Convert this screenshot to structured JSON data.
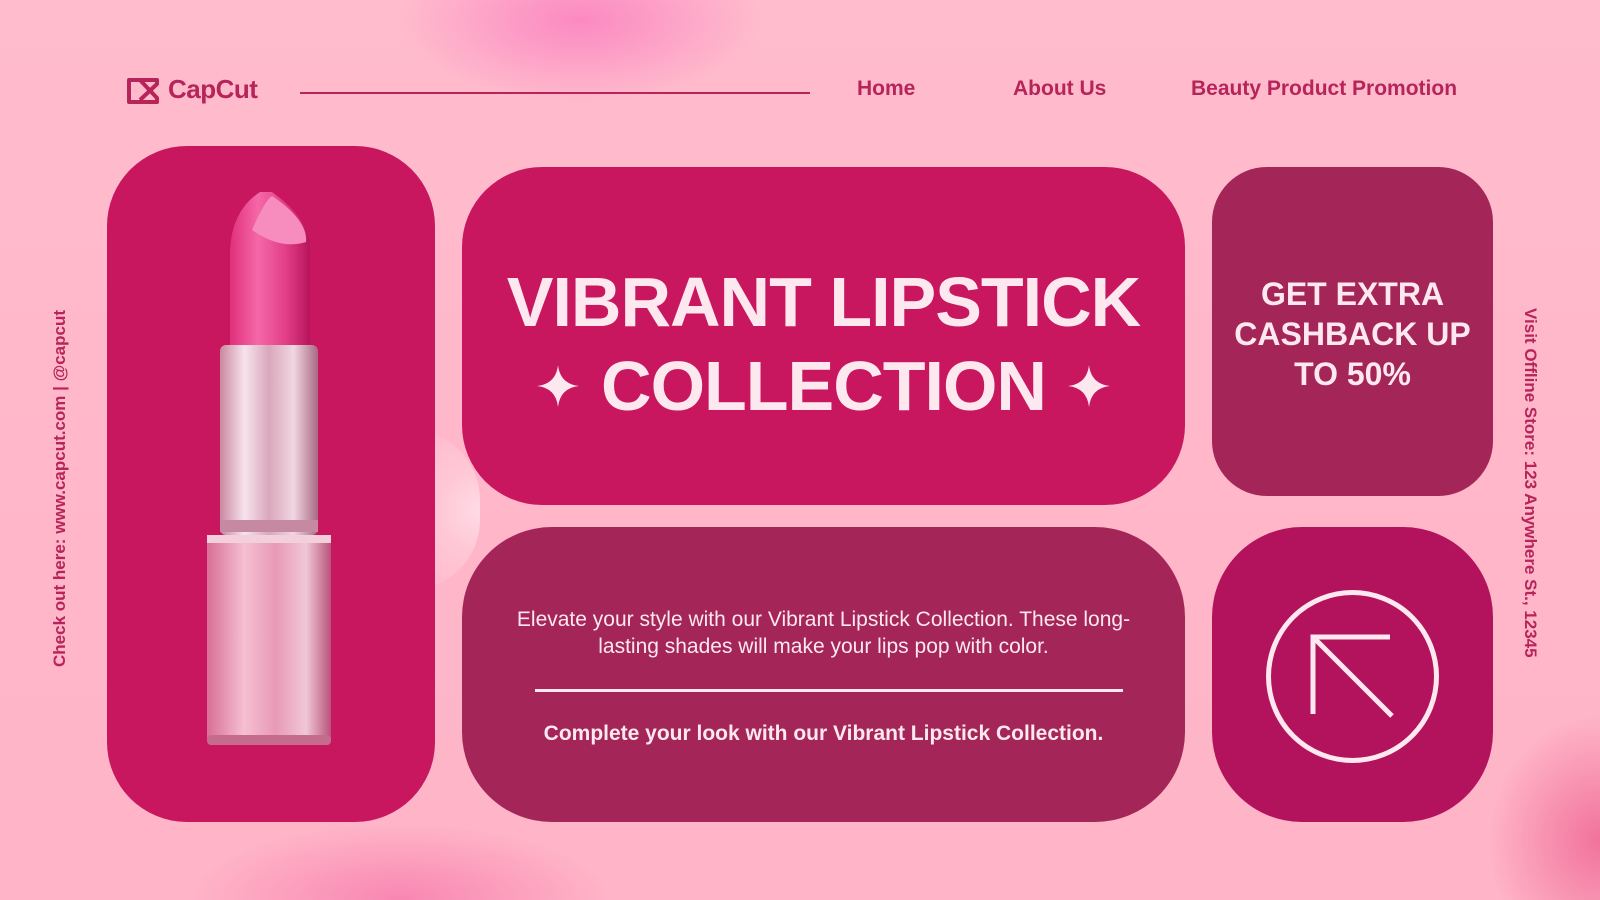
{
  "brand": {
    "name": "CapCut",
    "logo_icon": "capcut-logo-icon"
  },
  "nav": {
    "items": [
      "Home",
      "About Us",
      "Beauty Product Promotion"
    ]
  },
  "side": {
    "left_text": "Check out here: www.capcut.com | @capcut",
    "right_text": "Visit Offline Store: 123 Anywhere St., 12345"
  },
  "hero": {
    "title_line1": "VIBRANT LIPSTICK",
    "title_line2": "COLLECTION",
    "sparkle_icon": "sparkle-icon"
  },
  "promo": {
    "text": "GET EXTRA CASHBACK UP TO 50%"
  },
  "description": {
    "paragraph": "Elevate your style with our Vibrant Lipstick Collection. These long-lasting shades will make your lips pop with color.",
    "tagline": "Complete your look with our Vibrant Lipstick Collection."
  },
  "cta": {
    "icon": "arrow-up-left-icon"
  },
  "product": {
    "image": "lipstick-image"
  },
  "colors": {
    "background": "#ffb6c8",
    "accent": "#c8165f",
    "accent_dark": "#a42557",
    "text_brand": "#b6245a",
    "text_light": "#fde8ef"
  }
}
